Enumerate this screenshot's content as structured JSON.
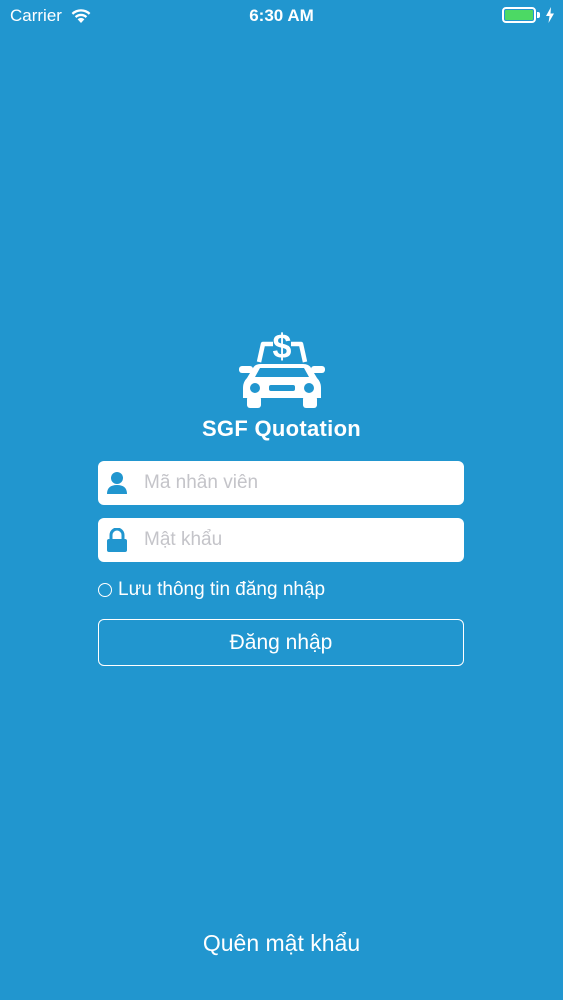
{
  "status_bar": {
    "carrier": "Carrier",
    "time": "6:30 AM",
    "battery_color": "#4cd964"
  },
  "brand": {
    "logo_icon": "car-dollar-icon",
    "title": "SGF Quotation"
  },
  "login_form": {
    "username_placeholder": "Mã nhân viên",
    "username_value": "",
    "username_icon": "user-icon",
    "password_placeholder": "Mật khẩu",
    "password_value": "",
    "password_icon": "lock-icon",
    "remember_label": "Lưu thông tin đăng nhập",
    "remember_checked": false,
    "submit_label": "Đăng nhập"
  },
  "footer": {
    "forgot_password_label": "Quên mật khẩu"
  },
  "colors": {
    "background": "#2196cf",
    "field_background": "#ffffff",
    "icon_color": "#2196cf",
    "placeholder_color": "#c4c4c9"
  }
}
